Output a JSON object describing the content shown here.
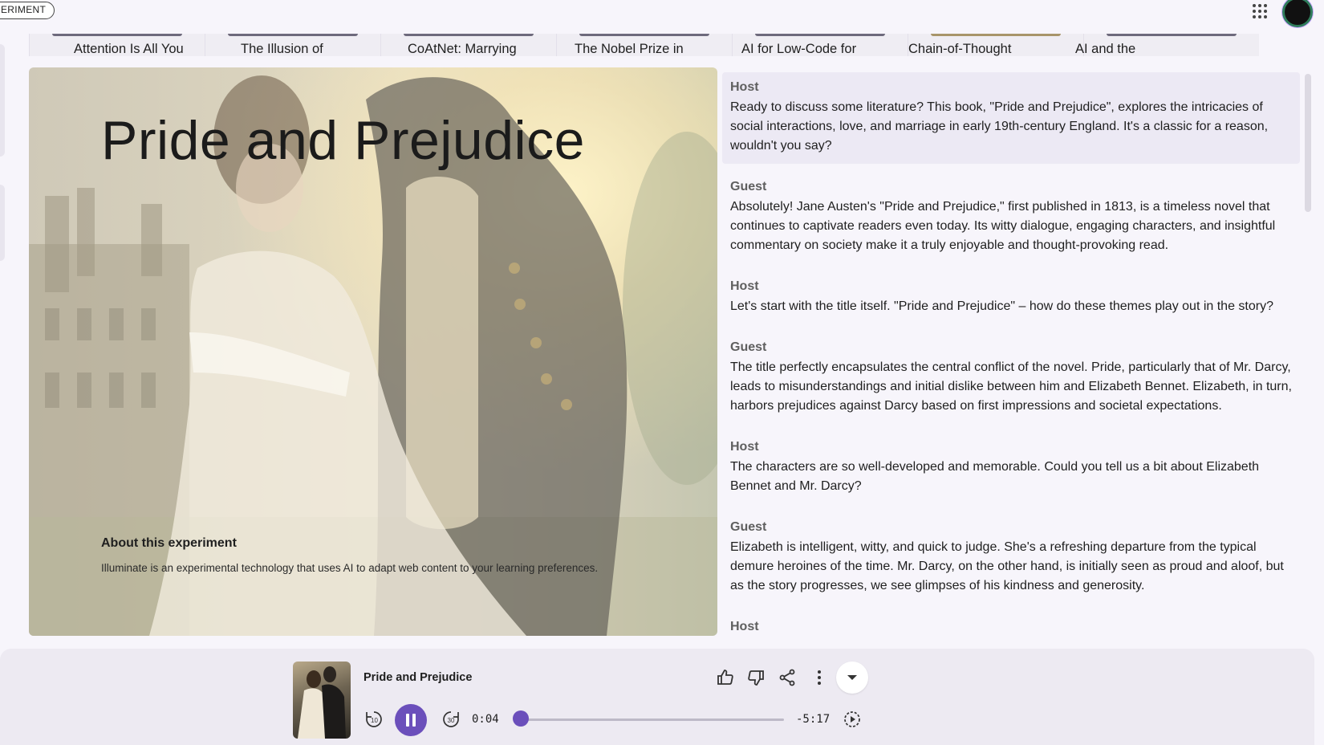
{
  "topbar": {
    "experiment_chip": "ERIMENT",
    "apps_icon": "apps-grid-icon",
    "avatar_icon": "account-avatar"
  },
  "carousel": {
    "items": [
      {
        "title": "Attention Is All You"
      },
      {
        "title": "The Illusion of"
      },
      {
        "title": "CoAtNet: Marrying"
      },
      {
        "title": "The Nobel Prize in"
      },
      {
        "title": "AI for Low-Code for"
      },
      {
        "title": "Chain-of-Thought"
      },
      {
        "title": "AI and the"
      }
    ]
  },
  "hero": {
    "title": "Pride and Prejudice",
    "about_heading": "About this experiment",
    "about_body": "Illuminate is an experimental technology that uses AI to adapt web content to your learning preferences."
  },
  "transcript": {
    "turns": [
      {
        "speaker": "Host",
        "text": "Ready to discuss some literature? This book, \"Pride and Prejudice\", explores the intricacies of social interactions, love, and marriage in early 19th-century England. It's a classic for a reason, wouldn't you say?"
      },
      {
        "speaker": "Guest",
        "text": "Absolutely! Jane Austen's \"Pride and Prejudice,\" first published in 1813, is a timeless novel that continues to captivate readers even today. Its witty dialogue, engaging characters, and insightful commentary on society make it a truly enjoyable and thought-provoking read."
      },
      {
        "speaker": "Host",
        "text": "Let's start with the title itself. \"Pride and Prejudice\" – how do these themes play out in the story?"
      },
      {
        "speaker": "Guest",
        "text": "The title perfectly encapsulates the central conflict of the novel. Pride, particularly that of Mr. Darcy, leads to misunderstandings and initial dislike between him and Elizabeth Bennet. Elizabeth, in turn, harbors prejudices against Darcy based on first impressions and societal expectations."
      },
      {
        "speaker": "Host",
        "text": "The characters are so well-developed and memorable. Could you tell us a bit about Elizabeth Bennet and Mr. Darcy?"
      },
      {
        "speaker": "Guest",
        "text": "Elizabeth is intelligent, witty, and quick to judge. She's a refreshing departure from the typical demure heroines of the time. Mr. Darcy, on the other hand, is initially seen as proud and aloof, but as the story progresses, we see glimpses of his kindness and generosity."
      },
      {
        "speaker": "Host",
        "text": ""
      }
    ]
  },
  "player": {
    "title": "Pride and Prejudice",
    "elapsed": "0:04",
    "remaining": "-5:17",
    "progress_fraction": 0.013,
    "icons": {
      "like": "thumb-up-icon",
      "dislike": "thumb-down-icon",
      "share": "share-icon",
      "more": "more-vert-icon",
      "collapse": "chevron-down-icon",
      "rewind": "replay-10-icon",
      "pause": "pause-icon",
      "forward": "forward-30-icon",
      "speed": "playback-speed-icon"
    },
    "accent_color": "#6b4fbb"
  }
}
